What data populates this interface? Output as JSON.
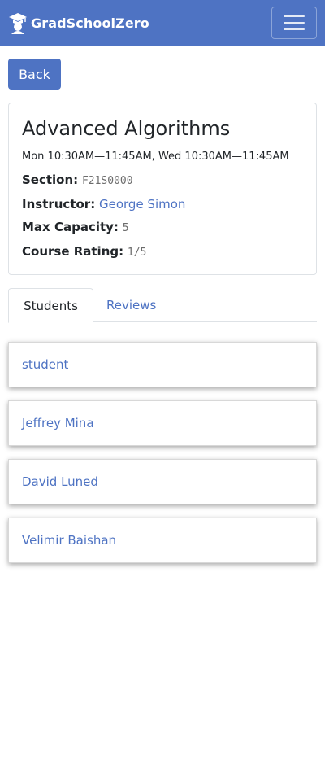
{
  "app": {
    "brand": "GradSchoolZero"
  },
  "nav": {
    "back_label": "Back"
  },
  "course": {
    "title": "Advanced Algorithms",
    "schedule": "Mon 10:30AM—11:45AM, Wed 10:30AM—11:45AM",
    "section_label": "Section:",
    "section_value": "F21S0000",
    "instructor_label": "Instructor:",
    "instructor_value": "George Simon",
    "capacity_label": "Max Capacity:",
    "capacity_value": "5",
    "rating_label": "Course Rating:",
    "rating_value": "1/5"
  },
  "tabs": [
    {
      "label": "Students",
      "active": true
    },
    {
      "label": "Reviews",
      "active": false
    }
  ],
  "students": [
    {
      "name": "student"
    },
    {
      "name": "Jeffrey Mina"
    },
    {
      "name": "David Luned"
    },
    {
      "name": "Velimir Baishan"
    }
  ]
}
